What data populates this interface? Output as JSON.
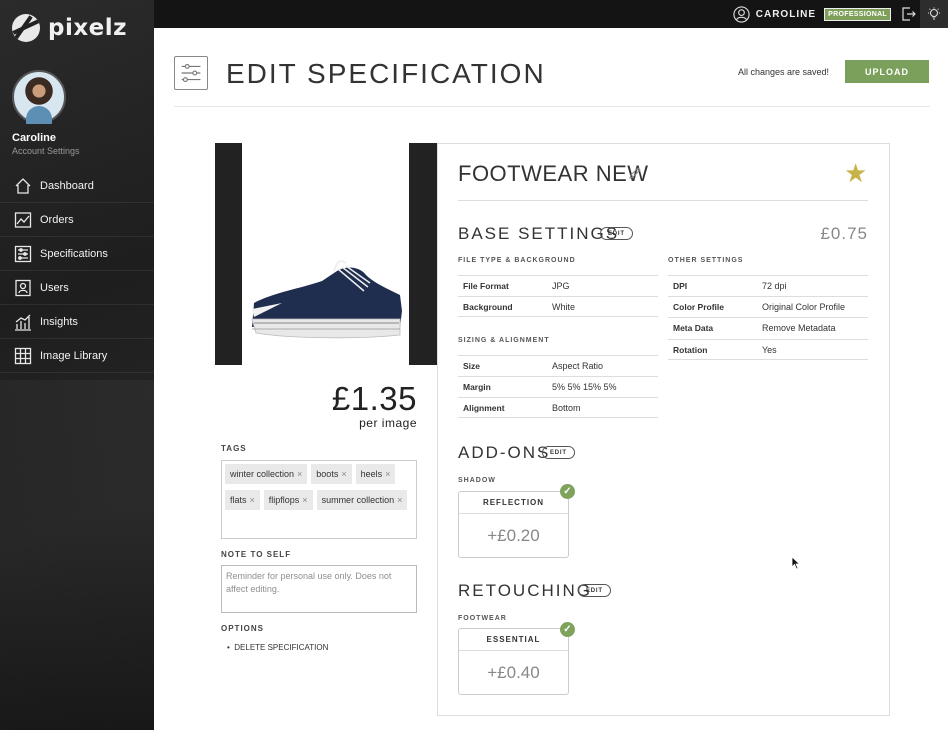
{
  "brand": {
    "name": "pixelz"
  },
  "user": {
    "name": "Caroline",
    "subtitle": "Account Settings"
  },
  "sidebar": {
    "items": [
      {
        "label": "Dashboard",
        "icon": "home-icon"
      },
      {
        "label": "Orders",
        "icon": "orders-chart-icon"
      },
      {
        "label": "Specifications",
        "icon": "sliders-icon"
      },
      {
        "label": "Users",
        "icon": "user-card-icon"
      },
      {
        "label": "Insights",
        "icon": "bar-chart-icon"
      },
      {
        "label": "Image Library",
        "icon": "grid-icon"
      }
    ]
  },
  "topbar": {
    "username": "CAROLINE",
    "badge": "PROFESSIONAL"
  },
  "header": {
    "title": "EDIT SPECIFICATION",
    "saved_status": "All changes are saved!",
    "upload_label": "UPLOAD"
  },
  "pricing": {
    "price": "£1.35",
    "per_image": "per image"
  },
  "tags": {
    "label": "TAGS",
    "items": [
      "winter collection",
      "boots",
      "heels",
      "flats",
      "flipflops",
      "summer collection"
    ]
  },
  "note": {
    "label": "NOTE TO SELF",
    "placeholder": "Reminder for personal use only. Does not affect editing."
  },
  "options": {
    "label": "OPTIONS",
    "delete_label": "DELETE SPECIFICATION"
  },
  "spec": {
    "name": "FOOTWEAR NEW",
    "base": {
      "title": "BASE SETTINGS",
      "edit_label": "EDIT",
      "price": "£0.75",
      "file_type_label": "FILE TYPE & BACKGROUND",
      "file_type": [
        {
          "key": "File Format",
          "value": "JPG"
        },
        {
          "key": "Background",
          "value": "White"
        }
      ],
      "sizing_label": "SIZING & ALIGNMENT",
      "sizing": [
        {
          "key": "Size",
          "value": "Aspect Ratio"
        },
        {
          "key": "Margin",
          "value": "5% 5% 15% 5%"
        },
        {
          "key": "Alignment",
          "value": "Bottom"
        }
      ],
      "other_label": "OTHER SETTINGS",
      "other": [
        {
          "key": "DPI",
          "value": "72 dpi"
        },
        {
          "key": "Color Profile",
          "value": "Original Color Profile"
        },
        {
          "key": "Meta Data",
          "value": "Remove Metadata"
        },
        {
          "key": "Rotation",
          "value": "Yes"
        }
      ]
    },
    "addons": {
      "title": "ADD-ONS",
      "edit_label": "EDIT",
      "category": "SHADOW",
      "option_name": "REFLECTION",
      "option_price": "+£0.20"
    },
    "retouching": {
      "title": "RETOUCHING",
      "edit_label": "EDIT",
      "category": "FOOTWEAR",
      "option_name": "ESSENTIAL",
      "option_price": "+£0.40"
    }
  },
  "colors": {
    "accent_green": "#7ba05c",
    "star_gold": "#c8b34b",
    "sidebar_bg": "#222222"
  }
}
